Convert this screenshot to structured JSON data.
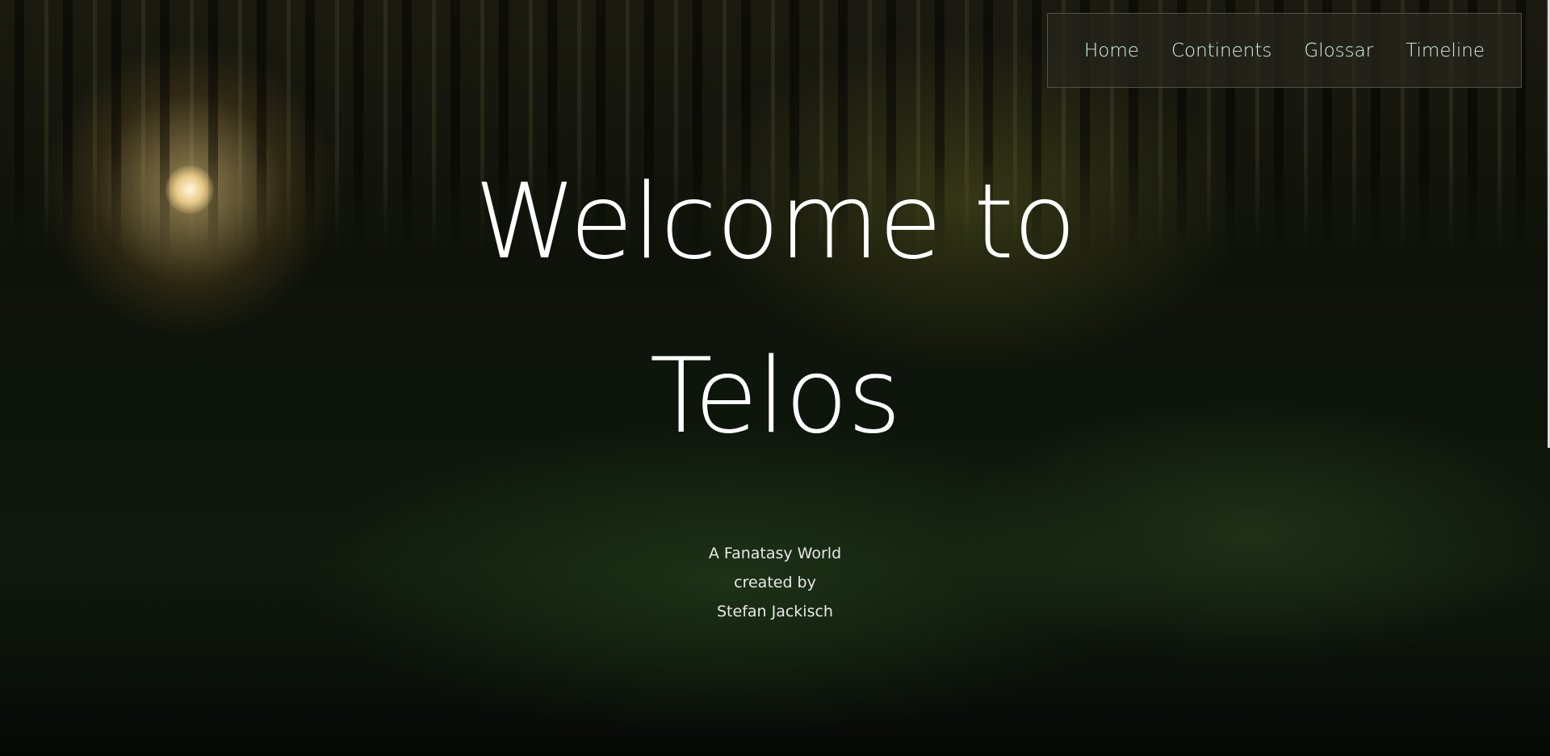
{
  "nav": {
    "items": [
      "Home",
      "Continents",
      "Glossar",
      "Timeline"
    ]
  },
  "hero": {
    "title_line1": "Welcome to",
    "title_line2": "Telos"
  },
  "subtitle": {
    "line1": "A Fanatasy World",
    "line2": "created by",
    "line3": "Stefan Jackisch"
  }
}
